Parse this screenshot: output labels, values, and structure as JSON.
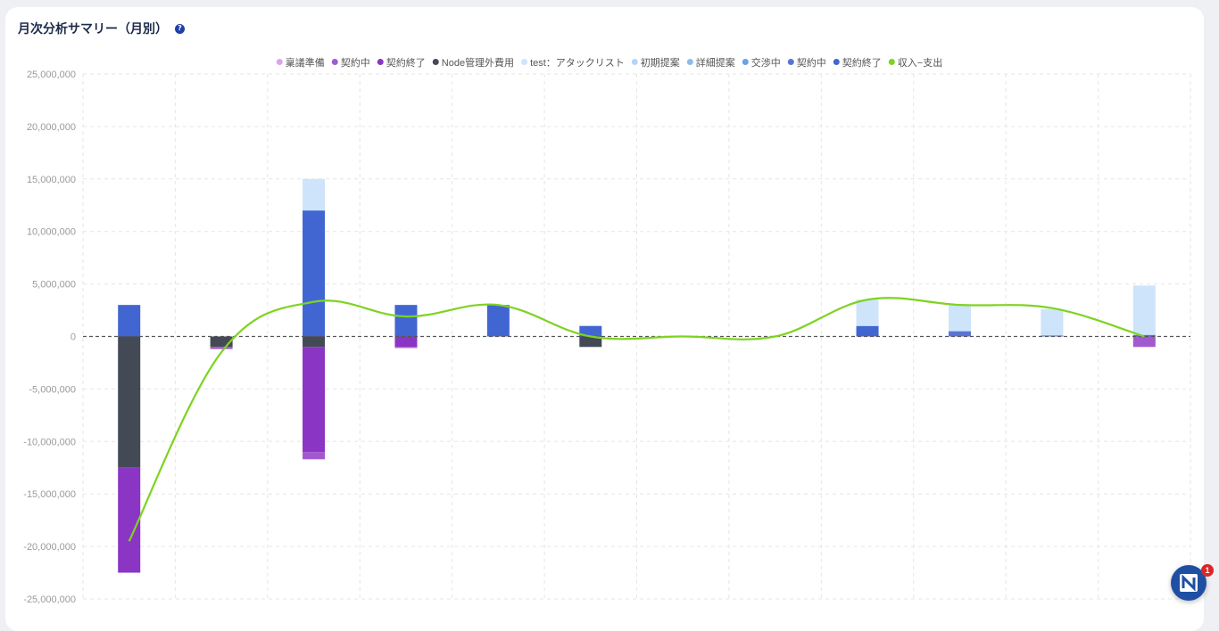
{
  "header": {
    "title": "月次分析サマリー（月別）",
    "help_icon": "?"
  },
  "fab": {
    "badge_count": "1",
    "icon": "notification-app-icon"
  },
  "chart_data": {
    "type": "bar",
    "stacked": true,
    "grid": true,
    "zero_line": "dashed",
    "legend_position": "top-center",
    "ylim": [
      -25000000,
      25000000
    ],
    "yticks": [
      25000000,
      20000000,
      15000000,
      10000000,
      5000000,
      0,
      -5000000,
      -10000000,
      -15000000,
      -20000000,
      -25000000
    ],
    "ytick_labels": [
      "25,000,000",
      "20,000,000",
      "15,000,000",
      "10,000,000",
      "5,000,000",
      "0",
      "-5,000,000",
      "-10,000,000",
      "-15,000,000",
      "-20,000,000",
      "-25,000,000"
    ],
    "category_count": 12,
    "legend": [
      {
        "name": "稟議準備",
        "color": "#d8a6ea"
      },
      {
        "name": "契約中",
        "color": "#a259cf"
      },
      {
        "name": "契約終了",
        "color": "#8a35c4"
      },
      {
        "name": "Node管理外費用",
        "color": "#444a55"
      },
      {
        "name": "test：アタックリスト",
        "color": "#cde4fb"
      },
      {
        "name": "初期提案",
        "color": "#b5d5f6"
      },
      {
        "name": "詳細提案",
        "color": "#8fbcee"
      },
      {
        "name": "交渉中",
        "color": "#6aa2e6"
      },
      {
        "name": "契約中",
        "color": "#5a74d6"
      },
      {
        "name": "契約終了",
        "color": "#4166d2"
      },
      {
        "name": "収入−支出",
        "color": "#7ed321"
      }
    ],
    "positive_series": [
      {
        "legend_index": 9,
        "values": [
          3000000,
          0,
          12000000,
          3000000,
          3000000,
          1000000,
          0,
          0,
          1000000,
          0,
          0,
          0
        ]
      },
      {
        "legend_index": 8,
        "values": [
          0,
          0,
          0,
          0,
          0,
          0,
          0,
          0,
          0,
          500000,
          100000,
          150000
        ]
      },
      {
        "legend_index": 4,
        "values": [
          0,
          0,
          3000000,
          0,
          0,
          0,
          0,
          0,
          2500000,
          2500000,
          2500000,
          3500000
        ]
      }
    ],
    "negative_series": [
      {
        "legend_index": 3,
        "values": [
          -12500000,
          -1000000,
          -1000000,
          0,
          0,
          -1000000,
          0,
          0,
          0,
          0,
          0,
          0
        ]
      },
      {
        "legend_index": 2,
        "values": [
          -10000000,
          0,
          -10000000,
          -1000000,
          0,
          0,
          0,
          0,
          0,
          0,
          0,
          0
        ]
      },
      {
        "legend_index": 1,
        "values": [
          0,
          -200000,
          -700000,
          -100000,
          0,
          0,
          0,
          0,
          0,
          0,
          0,
          0
        ]
      }
    ],
    "extra_bar": {
      "index": 11,
      "positive": [
        {
          "legend_index": 4,
          "value": 1200000
        }
      ],
      "negative": [
        {
          "legend_index": 1,
          "value": -1000000
        }
      ]
    },
    "line_series": {
      "legend_index": 10,
      "values": [
        -19500000,
        -1500000,
        3300000,
        1900000,
        3000000,
        0,
        0,
        0,
        3500000,
        3000000,
        2700000,
        3700000,
        0
      ]
    }
  }
}
